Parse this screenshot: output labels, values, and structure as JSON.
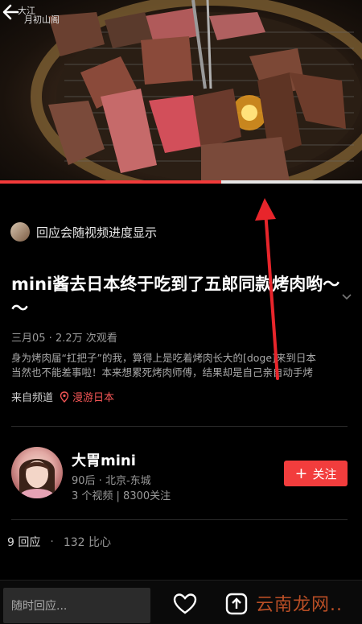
{
  "video": {
    "watermark_top": "大江",
    "watermark_bottom": "月初山阁",
    "progress_percent": 61
  },
  "notice": {
    "text": "回应会随视频进度显示"
  },
  "post": {
    "title": "mini酱去日本终于吃到了五郎同款烤肉哟～～",
    "meta": "三月05 · 2.2万 次观看",
    "description_line1": "身为烤肉届“扛把子”的我，算得上是吃着烤肉长大的[doge]来到日本",
    "description_line2": "当然也不能差事啦！本来想累死烤肉师傅，结果却是自己亲自动手烤",
    "channel_prefix": "来自频道",
    "channel_name": "漫游日本"
  },
  "author": {
    "name": "大胃mini",
    "info": "90后 · 北京-东城",
    "stats": "3 个视频 | 8300关注",
    "follow_label": "关注"
  },
  "comments": {
    "count_label": "9 回应",
    "ratio_label": "132 比心"
  },
  "bottom_bar": {
    "reply_placeholder": "随时回应...",
    "watermark": "云南龙网.."
  },
  "colors": {
    "accent": "#f23d3d",
    "background": "#000000",
    "annotation_arrow": "#e8252b"
  }
}
